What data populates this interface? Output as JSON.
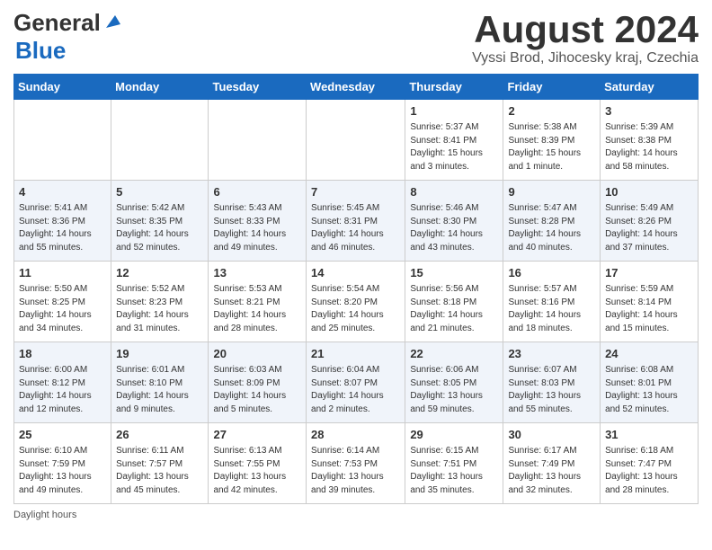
{
  "header": {
    "logo_line1": "General",
    "logo_line2": "Blue",
    "month_title": "August 2024",
    "location": "Vyssi Brod, Jihocesky kraj, Czechia"
  },
  "days_of_week": [
    "Sunday",
    "Monday",
    "Tuesday",
    "Wednesday",
    "Thursday",
    "Friday",
    "Saturday"
  ],
  "footer_note": "Daylight hours",
  "weeks": [
    [
      {
        "day": "",
        "info": ""
      },
      {
        "day": "",
        "info": ""
      },
      {
        "day": "",
        "info": ""
      },
      {
        "day": "",
        "info": ""
      },
      {
        "day": "1",
        "info": "Sunrise: 5:37 AM\nSunset: 8:41 PM\nDaylight: 15 hours\nand 3 minutes."
      },
      {
        "day": "2",
        "info": "Sunrise: 5:38 AM\nSunset: 8:39 PM\nDaylight: 15 hours\nand 1 minute."
      },
      {
        "day": "3",
        "info": "Sunrise: 5:39 AM\nSunset: 8:38 PM\nDaylight: 14 hours\nand 58 minutes."
      }
    ],
    [
      {
        "day": "4",
        "info": "Sunrise: 5:41 AM\nSunset: 8:36 PM\nDaylight: 14 hours\nand 55 minutes."
      },
      {
        "day": "5",
        "info": "Sunrise: 5:42 AM\nSunset: 8:35 PM\nDaylight: 14 hours\nand 52 minutes."
      },
      {
        "day": "6",
        "info": "Sunrise: 5:43 AM\nSunset: 8:33 PM\nDaylight: 14 hours\nand 49 minutes."
      },
      {
        "day": "7",
        "info": "Sunrise: 5:45 AM\nSunset: 8:31 PM\nDaylight: 14 hours\nand 46 minutes."
      },
      {
        "day": "8",
        "info": "Sunrise: 5:46 AM\nSunset: 8:30 PM\nDaylight: 14 hours\nand 43 minutes."
      },
      {
        "day": "9",
        "info": "Sunrise: 5:47 AM\nSunset: 8:28 PM\nDaylight: 14 hours\nand 40 minutes."
      },
      {
        "day": "10",
        "info": "Sunrise: 5:49 AM\nSunset: 8:26 PM\nDaylight: 14 hours\nand 37 minutes."
      }
    ],
    [
      {
        "day": "11",
        "info": "Sunrise: 5:50 AM\nSunset: 8:25 PM\nDaylight: 14 hours\nand 34 minutes."
      },
      {
        "day": "12",
        "info": "Sunrise: 5:52 AM\nSunset: 8:23 PM\nDaylight: 14 hours\nand 31 minutes."
      },
      {
        "day": "13",
        "info": "Sunrise: 5:53 AM\nSunset: 8:21 PM\nDaylight: 14 hours\nand 28 minutes."
      },
      {
        "day": "14",
        "info": "Sunrise: 5:54 AM\nSunset: 8:20 PM\nDaylight: 14 hours\nand 25 minutes."
      },
      {
        "day": "15",
        "info": "Sunrise: 5:56 AM\nSunset: 8:18 PM\nDaylight: 14 hours\nand 21 minutes."
      },
      {
        "day": "16",
        "info": "Sunrise: 5:57 AM\nSunset: 8:16 PM\nDaylight: 14 hours\nand 18 minutes."
      },
      {
        "day": "17",
        "info": "Sunrise: 5:59 AM\nSunset: 8:14 PM\nDaylight: 14 hours\nand 15 minutes."
      }
    ],
    [
      {
        "day": "18",
        "info": "Sunrise: 6:00 AM\nSunset: 8:12 PM\nDaylight: 14 hours\nand 12 minutes."
      },
      {
        "day": "19",
        "info": "Sunrise: 6:01 AM\nSunset: 8:10 PM\nDaylight: 14 hours\nand 9 minutes."
      },
      {
        "day": "20",
        "info": "Sunrise: 6:03 AM\nSunset: 8:09 PM\nDaylight: 14 hours\nand 5 minutes."
      },
      {
        "day": "21",
        "info": "Sunrise: 6:04 AM\nSunset: 8:07 PM\nDaylight: 14 hours\nand 2 minutes."
      },
      {
        "day": "22",
        "info": "Sunrise: 6:06 AM\nSunset: 8:05 PM\nDaylight: 13 hours\nand 59 minutes."
      },
      {
        "day": "23",
        "info": "Sunrise: 6:07 AM\nSunset: 8:03 PM\nDaylight: 13 hours\nand 55 minutes."
      },
      {
        "day": "24",
        "info": "Sunrise: 6:08 AM\nSunset: 8:01 PM\nDaylight: 13 hours\nand 52 minutes."
      }
    ],
    [
      {
        "day": "25",
        "info": "Sunrise: 6:10 AM\nSunset: 7:59 PM\nDaylight: 13 hours\nand 49 minutes."
      },
      {
        "day": "26",
        "info": "Sunrise: 6:11 AM\nSunset: 7:57 PM\nDaylight: 13 hours\nand 45 minutes."
      },
      {
        "day": "27",
        "info": "Sunrise: 6:13 AM\nSunset: 7:55 PM\nDaylight: 13 hours\nand 42 minutes."
      },
      {
        "day": "28",
        "info": "Sunrise: 6:14 AM\nSunset: 7:53 PM\nDaylight: 13 hours\nand 39 minutes."
      },
      {
        "day": "29",
        "info": "Sunrise: 6:15 AM\nSunset: 7:51 PM\nDaylight: 13 hours\nand 35 minutes."
      },
      {
        "day": "30",
        "info": "Sunrise: 6:17 AM\nSunset: 7:49 PM\nDaylight: 13 hours\nand 32 minutes."
      },
      {
        "day": "31",
        "info": "Sunrise: 6:18 AM\nSunset: 7:47 PM\nDaylight: 13 hours\nand 28 minutes."
      }
    ]
  ]
}
